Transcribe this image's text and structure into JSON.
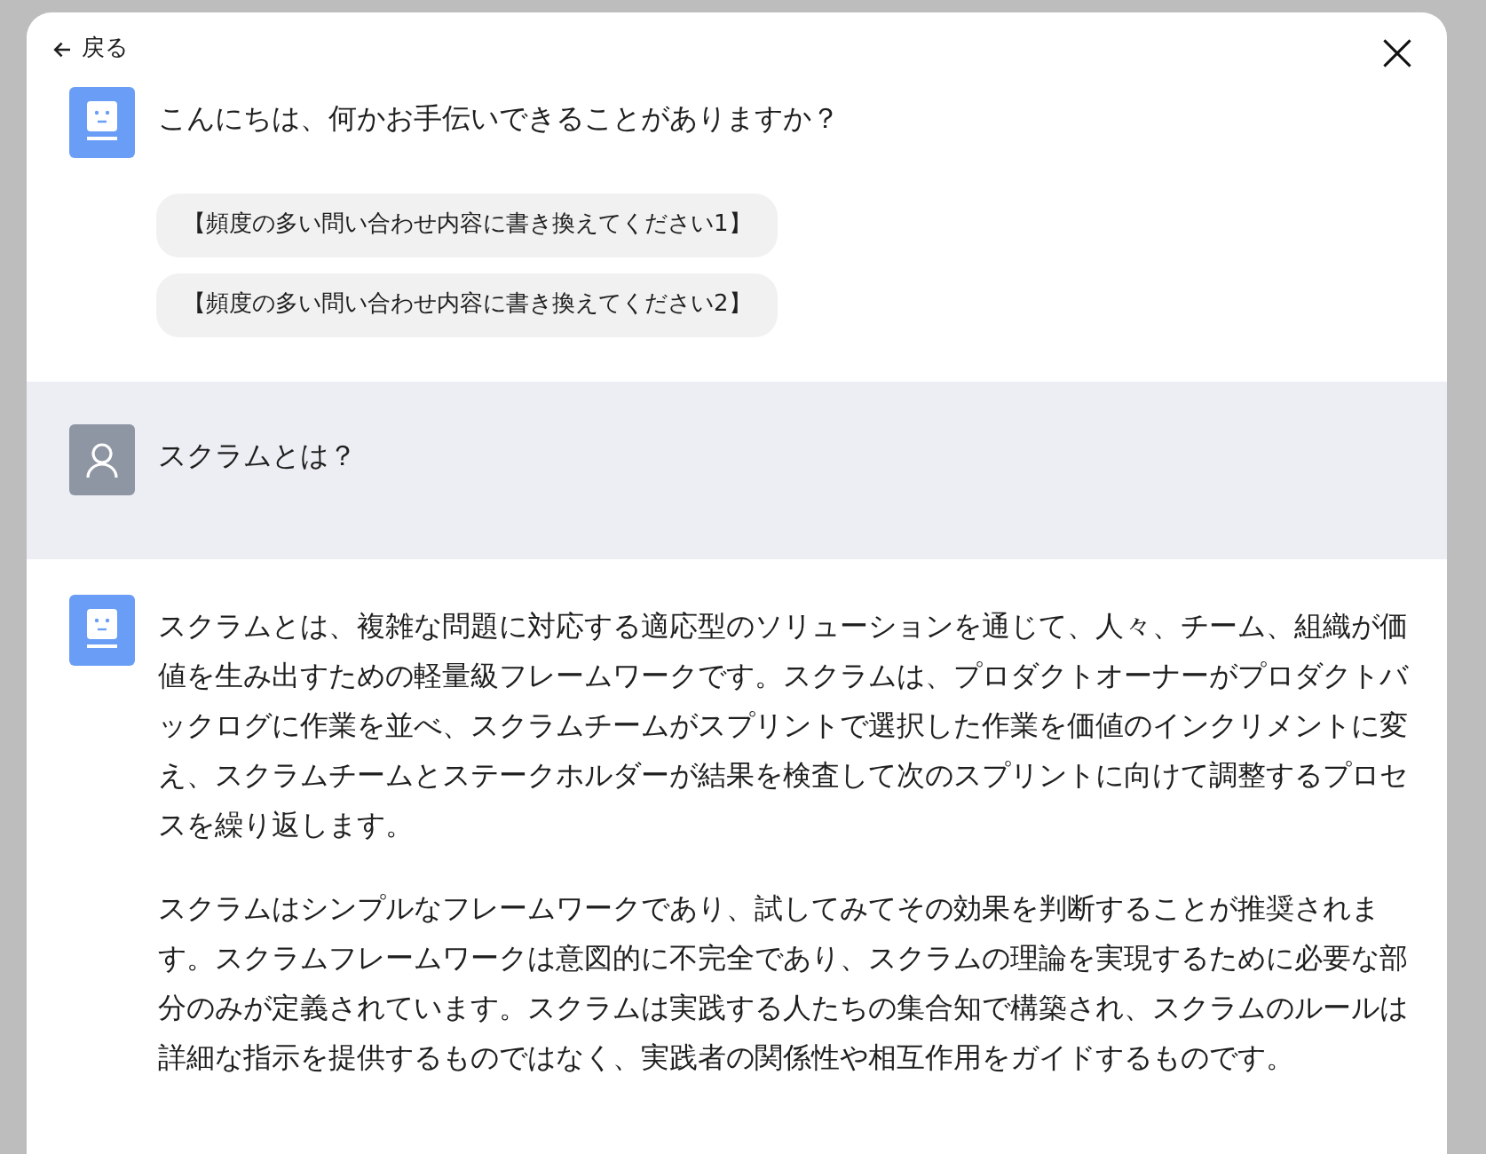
{
  "header": {
    "back_label": "戻る"
  },
  "messages": [
    {
      "kind": "bot",
      "paragraphs": [
        "こんにちは、何かお手伝いできることがありますか？"
      ],
      "suggestions": [
        "【頻度の多い問い合わせ内容に書き換えてください1】",
        "【頻度の多い問い合わせ内容に書き換えてください2】"
      ]
    },
    {
      "kind": "user",
      "paragraphs": [
        "スクラムとは？"
      ]
    },
    {
      "kind": "bot",
      "paragraphs": [
        "スクラムとは、複雑な問題に対応する適応型のソリューションを通じて、人々、チーム、組織が価値を生み出すための軽量級フレームワークです。スクラムは、プロダクトオーナーがプロダクトバックログに作業を並べ、スクラムチームがスプリントで選択した作業を価値のインクリメントに変え、スクラムチームとステークホルダーが結果を検査して次のスプリントに向けて調整するプロセスを繰り返します。",
        "スクラムはシンプルなフレームワークであり、試してみてその効果を判断することが推奨されます。スクラムフレームワークは意図的に不完全であり、スクラムの理論を実現するために必要な部分のみが定義されています。スクラムは実践する人たちの集合知で構築され、スクラムのルールは詳細な指示を提供するものではなく、実践者の関係性や相互作用をガイドするものです。"
      ]
    }
  ]
}
